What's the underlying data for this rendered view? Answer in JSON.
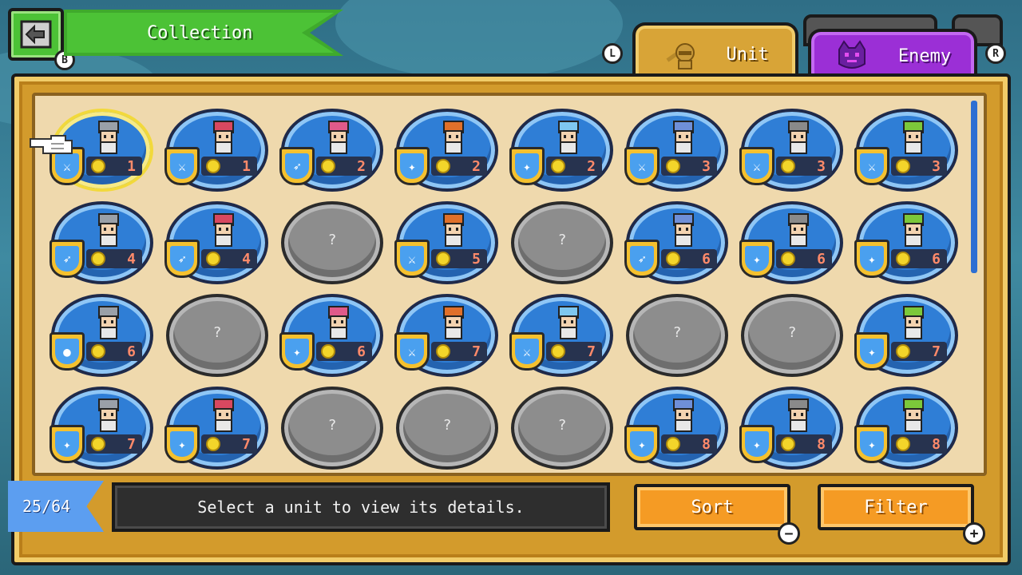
{
  "header": {
    "title": "Collection",
    "back_key": "B"
  },
  "tabs": {
    "left_key": "L",
    "right_key": "R",
    "items": [
      {
        "label": "Unit",
        "active": true,
        "icon": "knight-helmet-icon"
      },
      {
        "label": "Enemy",
        "active": false,
        "icon": "purple-cat-enemy-icon"
      }
    ]
  },
  "units": [
    {
      "locked": false,
      "cost": "1",
      "class": "sword",
      "selected": true
    },
    {
      "locked": false,
      "cost": "1",
      "class": "sword"
    },
    {
      "locked": false,
      "cost": "2",
      "class": "bow"
    },
    {
      "locked": false,
      "cost": "2",
      "class": "staff"
    },
    {
      "locked": false,
      "cost": "2",
      "class": "staff"
    },
    {
      "locked": false,
      "cost": "3",
      "class": "sword"
    },
    {
      "locked": false,
      "cost": "3",
      "class": "sword"
    },
    {
      "locked": false,
      "cost": "3",
      "class": "sword"
    },
    {
      "locked": false,
      "cost": "4",
      "class": "bow"
    },
    {
      "locked": false,
      "cost": "4",
      "class": "bow"
    },
    {
      "locked": true,
      "label": "?"
    },
    {
      "locked": false,
      "cost": "5",
      "class": "sword"
    },
    {
      "locked": true,
      "label": "?"
    },
    {
      "locked": false,
      "cost": "6",
      "class": "bow"
    },
    {
      "locked": false,
      "cost": "6",
      "class": "staff"
    },
    {
      "locked": false,
      "cost": "6",
      "class": "staff"
    },
    {
      "locked": false,
      "cost": "6",
      "class": "bomb"
    },
    {
      "locked": true,
      "label": "?"
    },
    {
      "locked": false,
      "cost": "6",
      "class": "staff"
    },
    {
      "locked": false,
      "cost": "7",
      "class": "sword"
    },
    {
      "locked": false,
      "cost": "7",
      "class": "sword"
    },
    {
      "locked": true,
      "label": "?"
    },
    {
      "locked": true,
      "label": "?"
    },
    {
      "locked": false,
      "cost": "7",
      "class": "staff"
    },
    {
      "locked": false,
      "cost": "7",
      "class": "staff"
    },
    {
      "locked": false,
      "cost": "7",
      "class": "staff"
    },
    {
      "locked": true,
      "label": "?"
    },
    {
      "locked": true,
      "label": "?"
    },
    {
      "locked": true,
      "label": "?"
    },
    {
      "locked": false,
      "cost": "8",
      "class": "staff"
    },
    {
      "locked": false,
      "cost": "8",
      "class": "staff"
    },
    {
      "locked": false,
      "cost": "8",
      "class": "staff"
    }
  ],
  "footer": {
    "count": "25/64",
    "message": "Select a unit to view its details.",
    "sort_label": "Sort",
    "filter_label": "Filter",
    "sort_key": "−",
    "filter_key": "+"
  },
  "colors": {
    "panel": "#d39b2c",
    "unit_oval": "#2f7ed6",
    "locked_oval": "#8d8d8d",
    "button": "#f59b24",
    "unit_tab": "#d8a437",
    "enemy_tab": "#9b2fd6",
    "header": "#4cc236"
  }
}
